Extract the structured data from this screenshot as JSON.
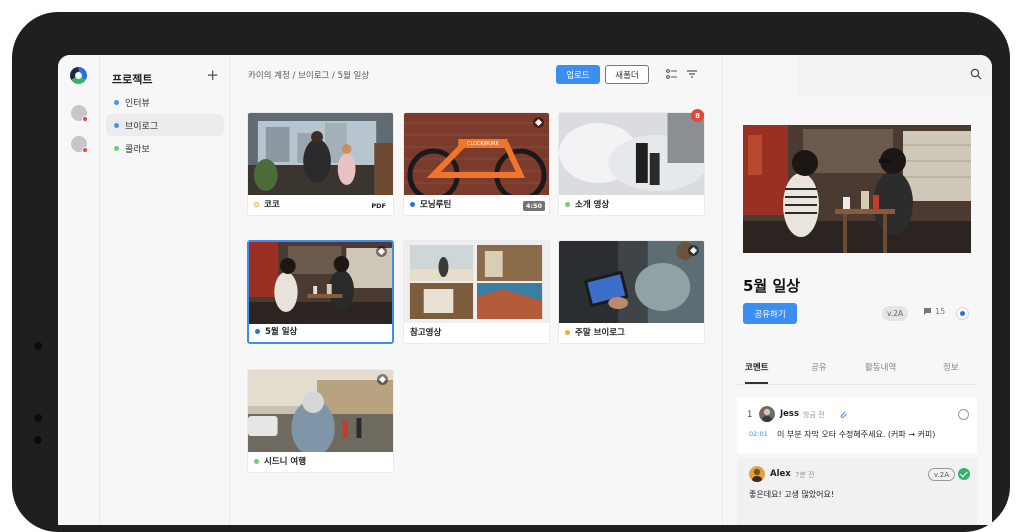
{
  "rail": {
    "avatars": [
      {
        "name": "user-1"
      },
      {
        "name": "user-2"
      }
    ]
  },
  "sidebar": {
    "title": "프로젝트",
    "add_label": "+",
    "items": [
      {
        "label": "인터뷰",
        "color": "#4a8ef0"
      },
      {
        "label": "브이로그",
        "color": "#4a8ef0",
        "active": true
      },
      {
        "label": "콜라보",
        "color": "#6ccf6e"
      }
    ]
  },
  "header": {
    "breadcrumb": "카이의 계정 /  브이로그 /  5월 일상",
    "upload_label": "업로드",
    "new_folder_label": "새폴더"
  },
  "cards": [
    {
      "label": "코코",
      "bullet": "#f4a93a",
      "bullet_style": "ring",
      "tag": "PDF"
    },
    {
      "label": "모닝루틴",
      "bullet": "#2c6fdc",
      "tag": "4:50"
    },
    {
      "label": "소개 영상",
      "bullet": "#6ccf6e",
      "badge": "8"
    },
    {
      "label": "5월 일상",
      "bullet": "#2c6fdc",
      "selected": true
    },
    {
      "label": "참고영상",
      "bullet": ""
    },
    {
      "label": "주말 브이로그",
      "bullet": "#f4a93a"
    },
    {
      "label": "시드니 여행",
      "bullet": "#6ccf6e"
    }
  ],
  "detail": {
    "title": "5월 일상",
    "share_label": "공유하기",
    "version": "v.2A",
    "comment_count": "15",
    "tabs": [
      "코멘트",
      "공유",
      "활동내역",
      "정보"
    ],
    "comments": [
      {
        "num": "1",
        "author": "Jess",
        "time": "방금 전",
        "timestamp": "02:01",
        "text": "이 부분 자막 오타 수정해주세요. (커파 → 커피)"
      },
      {
        "author": "Alex",
        "time": "7분 전",
        "version": "v.2A",
        "text": "좋은데요! 고생 많았어요!"
      }
    ]
  },
  "colors": {
    "accent": "#3d8ef3",
    "alert": "#e6453a",
    "success": "#35b26a"
  }
}
